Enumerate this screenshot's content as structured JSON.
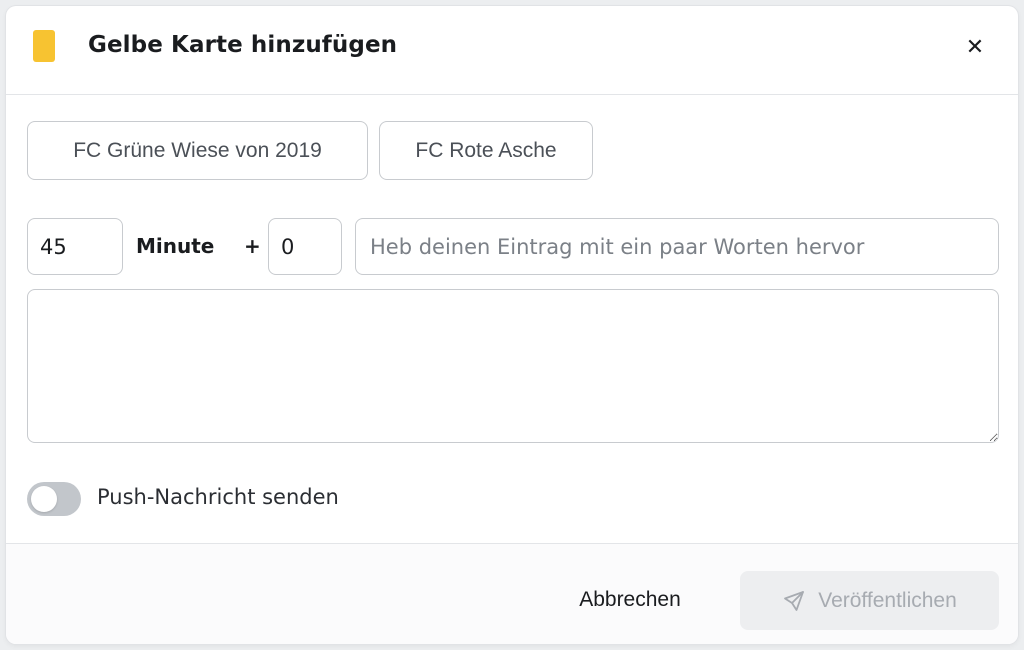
{
  "dialog": {
    "title": "Gelbe Karte hinzufügen",
    "card_icon": "yellow-card-icon",
    "close_icon": "close-icon",
    "close_symbol": "✕"
  },
  "teams": [
    {
      "label": "FC Grüne Wiese von 2019"
    },
    {
      "label": "FC Rote Asche"
    }
  ],
  "minute": {
    "value": "45",
    "label": "Minute",
    "plus": "+",
    "extra_value": "0"
  },
  "headline": {
    "value": "",
    "placeholder": "Heb deinen Eintrag mit ein paar Worten hervor"
  },
  "body_text": {
    "value": ""
  },
  "push": {
    "label": "Push-Nachricht senden",
    "enabled": false
  },
  "footer": {
    "cancel_label": "Abbrechen",
    "publish_label": "Veröffentlichen",
    "publish_icon": "send-icon"
  },
  "colors": {
    "yellow_card": "#f7c331",
    "toggle_off": "#c2c6cb",
    "publish_disabled_bg": "#edeef0",
    "publish_disabled_text": "#a7abb1"
  }
}
